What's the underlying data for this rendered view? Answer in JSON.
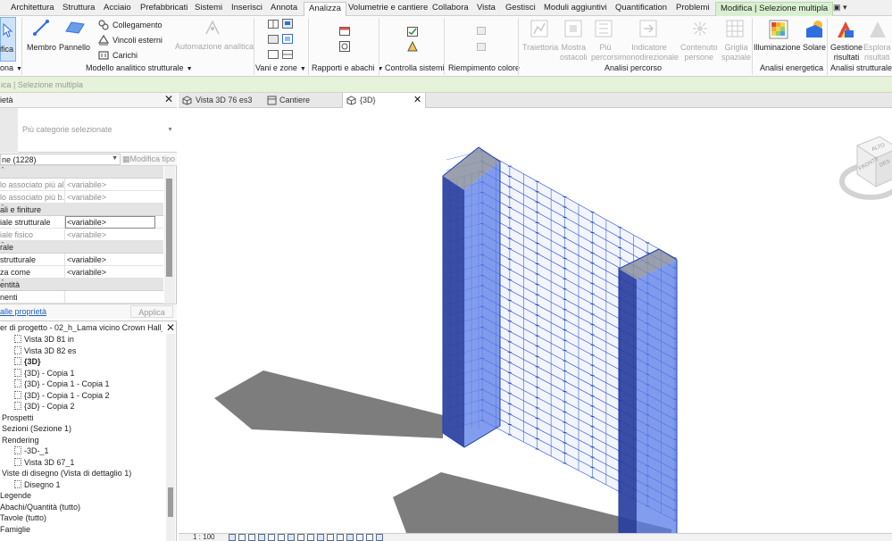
{
  "ribbon_tabs": [
    "Architettura",
    "Struttura",
    "Acciaio",
    "Prefabbricati",
    "Sistemi",
    "Inserisci",
    "Annota",
    "Analizza",
    "Volumetrie e cantiere",
    "Collabora",
    "Vista",
    "Gestisci",
    "Moduli aggiuntivi",
    "Quantification",
    "Problemi"
  ],
  "active_tab": "Analizza",
  "context_tab": "Modifica | Selezione multipla",
  "ribbon": {
    "modify_label": "ifica",
    "select_label": "ona",
    "buttons": {
      "membro": "Membro",
      "pannello": "Pannello",
      "collegamento": "Collegamento",
      "vincoli_esterni": "Vincoli esterni",
      "carichi": "Carichi",
      "automazione_analitica": "Automazione analitica",
      "traiettoria": "Traiettoria",
      "mostra_ostacoli": "Mostra\nostacoli",
      "piu_percorsi": "Più\npercorsi",
      "indicatore_monodirezionale": "Indicatore\nmonodirezionale",
      "contenuto_persone": "Contenuto\npersone",
      "griglia_spaziale": "Griglia\nspaziale",
      "illuminazione": "Illuminazione",
      "solare": "Solare",
      "gestione_risultati": "Gestione\nrisultati",
      "esplora_risultati": "Esplora\nrisultati"
    },
    "panels": {
      "modello_analitico": "Modello analitico strutturale",
      "vani_zone": "Vani e zone",
      "rapporti_abachi": "Rapporti e abachi",
      "controlla_sistemi": "Controlla sistemi",
      "riempimento_colore": "Riempimento colore",
      "analisi_percorso": "Analisi percorso",
      "analisi_energetica": "Analisi energetica",
      "analisi_strutturale": "Analisi strutturale"
    }
  },
  "options_bar": {
    "text": "ica | Selezione multipla"
  },
  "view_tabs": [
    {
      "label": "Vista 3D 76 es3"
    },
    {
      "label": "Cantiere"
    },
    {
      "label": "{3D}",
      "active": true
    }
  ],
  "properties": {
    "title": "ietà",
    "type_selector": "Più categorie selezionate",
    "instance_filter": "ne (1228)",
    "edit_type": "Modifica tipo",
    "rows": [
      {
        "kind": "header",
        "label": ""
      },
      {
        "key": "lo associato più al...",
        "value": "<variabile>",
        "dim": true
      },
      {
        "key": "lo associato più b...",
        "value": "<variabile>",
        "dim": true
      },
      {
        "kind": "header",
        "label": "ali e finiture"
      },
      {
        "key": "iale strutturale",
        "value": "<variabile>",
        "dim": false,
        "boxed": true
      },
      {
        "key": "iale fisico",
        "value": "<variabile>",
        "dim": true
      },
      {
        "kind": "header",
        "label": "rale"
      },
      {
        "key": " strutturale",
        "value": "<variabile>",
        "dim": false
      },
      {
        "key": "za come",
        "value": "<variabile>",
        "dim": false
      },
      {
        "kind": "header",
        "label": "entità"
      },
      {
        "key": "nenti",
        "value": "",
        "dim": false
      }
    ],
    "help_link": "alle proprietà",
    "apply": "Applica"
  },
  "browser": {
    "title": "er di progetto - 02_h_Lama vicino Crown Hall_t...",
    "items": [
      {
        "label": "Vista 3D 81 in",
        "level": 2,
        "icon": true
      },
      {
        "label": "Vista 3D 82 es",
        "level": 2,
        "icon": true
      },
      {
        "label": "{3D}",
        "level": 2,
        "icon": true,
        "bold": true
      },
      {
        "label": "{3D} - Copia 1",
        "level": 2,
        "icon": true
      },
      {
        "label": "{3D} - Copia 1 - Copia 1",
        "level": 2,
        "icon": true
      },
      {
        "label": "{3D} - Copia 1 - Copia 2",
        "level": 2,
        "icon": true
      },
      {
        "label": "{3D} - Copia 2",
        "level": 2,
        "icon": true
      },
      {
        "label": "Prospetti",
        "level": 1,
        "icon": false
      },
      {
        "label": "Sezioni (Sezione 1)",
        "level": 1,
        "icon": false
      },
      {
        "label": "Rendering",
        "level": 1,
        "icon": false
      },
      {
        "label": "-3D-_1",
        "level": 2,
        "icon": true
      },
      {
        "label": "Vista 3D 67_1",
        "level": 2,
        "icon": true
      },
      {
        "label": "Viste di disegno (Vista di dettaglio 1)",
        "level": 1,
        "icon": false
      },
      {
        "label": "Disegno 1",
        "level": 2,
        "icon": true
      },
      {
        "label": "Legende",
        "level": 0,
        "icon": false
      },
      {
        "label": "Abachi/Quantità (tutto)",
        "level": 0,
        "icon": false
      },
      {
        "label": "Tavole (tutto)",
        "level": 0,
        "icon": false
      },
      {
        "label": "Famiglie",
        "level": 0,
        "icon": false
      }
    ]
  },
  "status": {
    "scale": "1 : 100"
  },
  "viewcube": {
    "front_label": "FRONTE",
    "top_label": "ALTO",
    "right_label": "DES"
  },
  "colors": {
    "accent": "#2f6fe0",
    "active_tab_border": "#2f6fe0",
    "context_tab_bg": "#d9f0d0",
    "options_bar_bg": "#e6f2d9",
    "structure_blue": "#3f62d6",
    "structure_fill": "#5a7ce8",
    "shadow_gray": "#6f6f6f",
    "annotation_stroke": "#a0155a"
  }
}
